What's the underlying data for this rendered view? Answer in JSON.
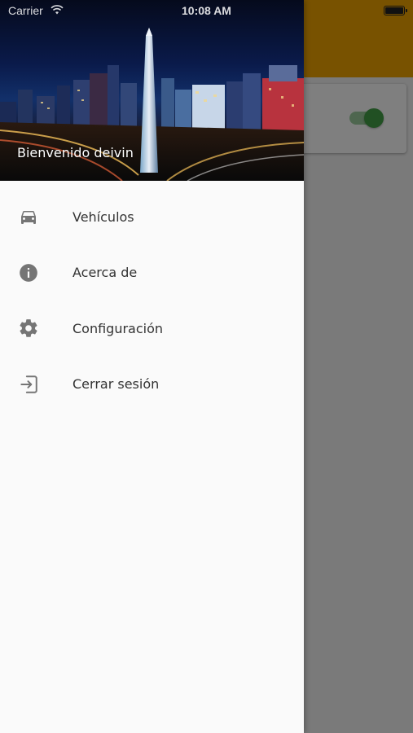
{
  "status_bar": {
    "carrier": "Carrier",
    "time": "10:08 AM",
    "wifi_icon": "wifi-icon",
    "battery_icon": "battery-full-icon"
  },
  "drawer": {
    "header_image": "buenos-aires-obelisk-night-photo",
    "welcome_text": "Bienvenido deivin",
    "items": [
      {
        "label": "Vehículos",
        "icon": "car-icon"
      },
      {
        "label": "Acerca de",
        "icon": "info-icon"
      },
      {
        "label": "Configuración",
        "icon": "gear-icon"
      },
      {
        "label": "Cerrar sesión",
        "icon": "logout-icon"
      }
    ]
  },
  "background_app": {
    "appbar_color": "#f0a500",
    "switch_state": "on",
    "switch_color": "#43a047"
  },
  "colors": {
    "drawer_bg": "#fafafa",
    "icon": "#757575",
    "text": "#333333",
    "scrim": "rgba(0,0,0,0.5)"
  }
}
